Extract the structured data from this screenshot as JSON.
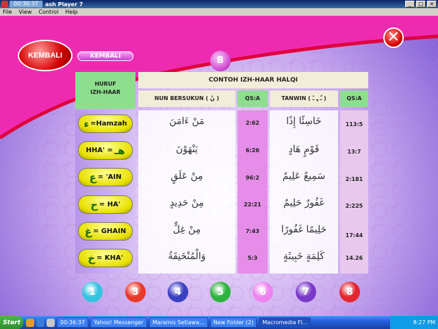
{
  "window": {
    "timer": "00:36:37",
    "title": "ash Player 7",
    "buttons": [
      "_",
      "□",
      "×"
    ]
  },
  "menu": [
    "File",
    "View",
    "Control",
    "Help"
  ],
  "stage": {
    "kembali_main": "KEMBALI",
    "kembali_small": "KEMBALI",
    "close_symbol": "✕",
    "section_ball": "B",
    "table": {
      "left_header": [
        "HURUF",
        "IZH-HAAR"
      ],
      "title": "CONTOH IZH-HAAR HALQI",
      "sub_nun": "NUN  BERSUKUN (  نْ   )",
      "sub_qs1": "QS:A",
      "sub_tanwin": "TANWIN (  ـٌ  ـٍ  ـً  )",
      "sub_qs2": "QS:A",
      "rows": [
        {
          "letter_ar": "ء",
          "letter_label": "=Hamzah",
          "nun_example": "مَنْ ءَامَنَ",
          "qs1": "2:62",
          "tanwin_example": "خَاسِئًا إِذًا",
          "qs2": "113:5"
        },
        {
          "letter_ar": "هـ",
          "letter_label": "HHA' =",
          "nun_example": "يَنْهَوْنَ",
          "qs1": "6:26",
          "tanwin_example": "قَوْمٍ هَادٍ",
          "qs2": "13:7"
        },
        {
          "letter_ar": "ع",
          "letter_label": "= 'AIN",
          "nun_example": "مِنْ عَلَقٍ",
          "qs1": "96:2",
          "tanwin_example": "سَمِيعٌ عَلِيمٌ",
          "qs2": "2:181"
        },
        {
          "letter_ar": "ح",
          "letter_label": "= HA'",
          "nun_example": "مِنْ حَدِيدٍ",
          "qs1": "22:21",
          "tanwin_example": "غَفُورٌ حَلِيمٌ",
          "qs2": "2:225"
        },
        {
          "letter_ar": "غ",
          "letter_label": "= GHAIN",
          "nun_example": "مِنْ غِلٍّ",
          "qs1": "7:43",
          "tanwin_example": "حَلِيمًا غَفُورًا",
          "qs2": "17:44"
        },
        {
          "letter_ar": "خ",
          "letter_label": "= KHA'",
          "nun_example": "وَالْمُنْخَنِقَةُ",
          "qs1": "5:3",
          "tanwin_example": "كَلِمَةٍ خَبِيثَةٍ",
          "qs2": "14.26"
        }
      ]
    },
    "number_balls": [
      {
        "label": "1",
        "color": "#35c3e0"
      },
      {
        "label": "3",
        "color": "#e83a2a"
      },
      {
        "label": "4",
        "color": "#3b3fc2"
      },
      {
        "label": "5",
        "color": "#2eb43e"
      },
      {
        "label": "6",
        "color": "#ee82ee"
      },
      {
        "label": "7",
        "color": "#7a38c9"
      },
      {
        "label": "8",
        "color": "#e3262f"
      }
    ]
  },
  "taskbar": {
    "start": "Start",
    "tasks": [
      {
        "label": "00:36:37",
        "active": false
      },
      {
        "label": "Yahoo! Messenger",
        "active": false
      },
      {
        "label": "Maramis Setiawa...",
        "active": false
      },
      {
        "label": "New Folder (2)",
        "active": false
      },
      {
        "label": "Macromedia Fl...",
        "active": true
      }
    ],
    "clock": "8:27 PM"
  }
}
